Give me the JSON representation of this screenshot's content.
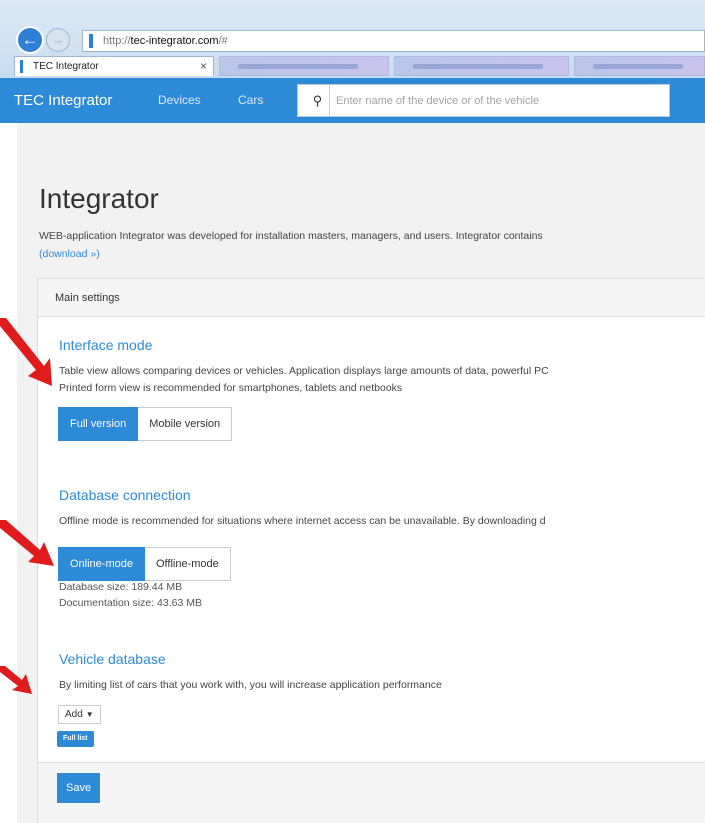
{
  "browser": {
    "url_protocol": "http://",
    "url_host": "tec-integrator.com",
    "url_path": "/#",
    "active_tab_title": "TEC Integrator",
    "tab_close_glyph": "×"
  },
  "navbar": {
    "brand": "TEC Integrator",
    "links": [
      "Devices",
      "Cars"
    ],
    "search_placeholder": "Enter name of the device or of the vehicle",
    "search_icon": "search-icon",
    "bg_color": "#2d8ad6"
  },
  "page": {
    "title": "Integrator",
    "lead": "WEB-application Integrator was developed for installation masters, managers, and users. Integrator contains",
    "download_link": "(download »)"
  },
  "panel": {
    "heading": "Main settings",
    "interface": {
      "title": "Interface mode",
      "desc_line1": "Table view allows comparing devices or vehicles. Application displays large amounts of data, powerful PC",
      "desc_line2": "Printed form view is recommended for smartphones, tablets and netbooks",
      "options": [
        "Full version",
        "Mobile version"
      ],
      "selected": "Full version"
    },
    "database": {
      "title": "Database connection",
      "desc": "Offline mode is recommended for situations where internet access can be unavailable. By downloading d",
      "options": [
        "Online-mode",
        "Offline-mode"
      ],
      "selected": "Online-mode",
      "db_size": "Database size: 189.44 MB",
      "doc_size": "Documentation size: 43.63 MB"
    },
    "vehicles": {
      "title": "Vehicle database",
      "desc": "By limiting list of cars that you work with, you will increase application performance",
      "add_label": "Add",
      "tag_label": "Full list"
    },
    "save_label": "Save"
  },
  "colors": {
    "accent": "#2d8ad6",
    "annotation_arrow": "#e01b1b"
  }
}
